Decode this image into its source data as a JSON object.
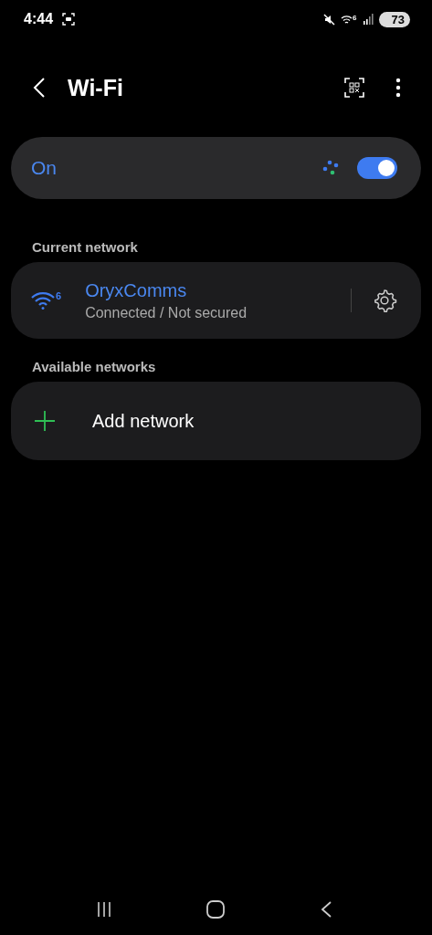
{
  "status_bar": {
    "time": "4:44",
    "wifi_standard": "6",
    "battery": "73"
  },
  "header": {
    "title": "Wi-Fi"
  },
  "master_switch": {
    "label": "On",
    "on": true
  },
  "current_section": {
    "title": "Current network"
  },
  "current_network": {
    "name": "OryxComms",
    "status": "Connected / Not secured",
    "wifi_standard": "6"
  },
  "available_section": {
    "title": "Available networks"
  },
  "add_network": {
    "label": "Add network"
  }
}
